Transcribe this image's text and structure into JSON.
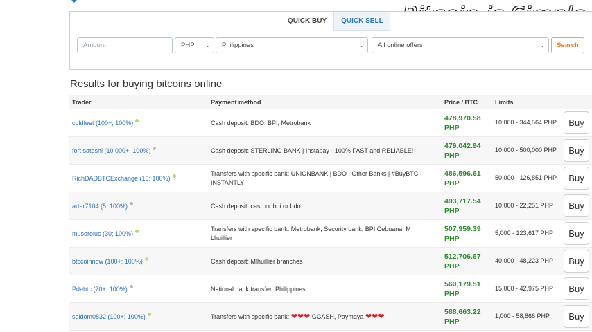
{
  "watermark": "Bitcoin is Simple",
  "tabs": {
    "quick_buy": "QUICK BUY",
    "quick_sell": "QUICK SELL"
  },
  "search": {
    "amount_placeholder": "Amount",
    "currency": "PHP",
    "country": "Philippines",
    "offer_type": "All online offers",
    "button": "Search"
  },
  "results_title": "Results for buying bitcoins online",
  "columns": {
    "trader": "Trader",
    "payment": "Payment method",
    "price": "Price / BTC",
    "limits": "Limits"
  },
  "colors": {
    "online": "#b5d86a",
    "offline": "#b8b8b8",
    "price": "#2a8a2a",
    "link": "#2d6fb6"
  },
  "rows": [
    {
      "trader": "coldfeet (100+; 100%)",
      "status": "online",
      "payment_line1": "Cash deposit: BDO, BPI, Metrobank",
      "payment_line2": "",
      "price": "478,970.58",
      "currency": "PHP",
      "limits": "10,000 - 344,564 PHP",
      "buy": "Buy"
    },
    {
      "trader": "fort.satoshi (10 000+; 100%)",
      "status": "online",
      "payment_line1": "Cash deposit: STERLING BANK | Instapay - 100% FAST and RELIABLE!",
      "payment_line2": "",
      "price": "479,042.94",
      "currency": "PHP",
      "limits": "10,000 - 500,000 PHP",
      "buy": "Buy"
    },
    {
      "trader": "RichDADBTCExchange (16; 100%)",
      "status": "online",
      "payment_line1": "Transfers with specific bank: UNIONBANK | BDO | Other Banks | #BuyBTC",
      "payment_line2": "INSTANTLY!",
      "price": "486,596.61",
      "currency": "PHP",
      "limits": "50,000 - 126,851 PHP",
      "buy": "Buy"
    },
    {
      "trader": "arter7104 (5; 100%)",
      "status": "offline",
      "payment_line1": "Cash deposit: cash or bpi or bdo",
      "payment_line2": "",
      "price": "493,717.54",
      "currency": "PHP",
      "limits": "10,000 - 22,251 PHP",
      "buy": "Buy"
    },
    {
      "trader": "musoroluc (30; 100%)",
      "status": "online",
      "payment_line1": "Transfers with specific bank: Metrobank, Security bank, BPI,Cebuana, M",
      "payment_line2": "Lhuillier",
      "price": "507,959.39",
      "currency": "PHP",
      "limits": "5,000 - 123,617 PHP",
      "buy": "Buy"
    },
    {
      "trader": "btccoinnow (100+; 100%)",
      "status": "online",
      "payment_line1": "Cash deposit: Mlhuillier branches",
      "payment_line2": "",
      "price": "512,706.67",
      "currency": "PHP",
      "limits": "40,000 - 48,223 PHP",
      "buy": "Buy"
    },
    {
      "trader": "Pdebtc (70+; 100%)",
      "status": "offline",
      "payment_line1": "National bank transfer: Philippines",
      "payment_line2": "",
      "price": "560,179.51",
      "currency": "PHP",
      "limits": "15,000 - 42,975 PHP",
      "buy": "Buy"
    },
    {
      "trader": "seldom0832 (100+; 100%)",
      "status": "online",
      "payment_prefix": "Transfers with specific bank:",
      "payment_middle": "GCASH, Paymaya",
      "hearts": "❤❤❤",
      "price": "588,663.22",
      "currency": "PHP",
      "limits": "1,000 - 58,866 PHP",
      "buy": "Buy"
    }
  ]
}
